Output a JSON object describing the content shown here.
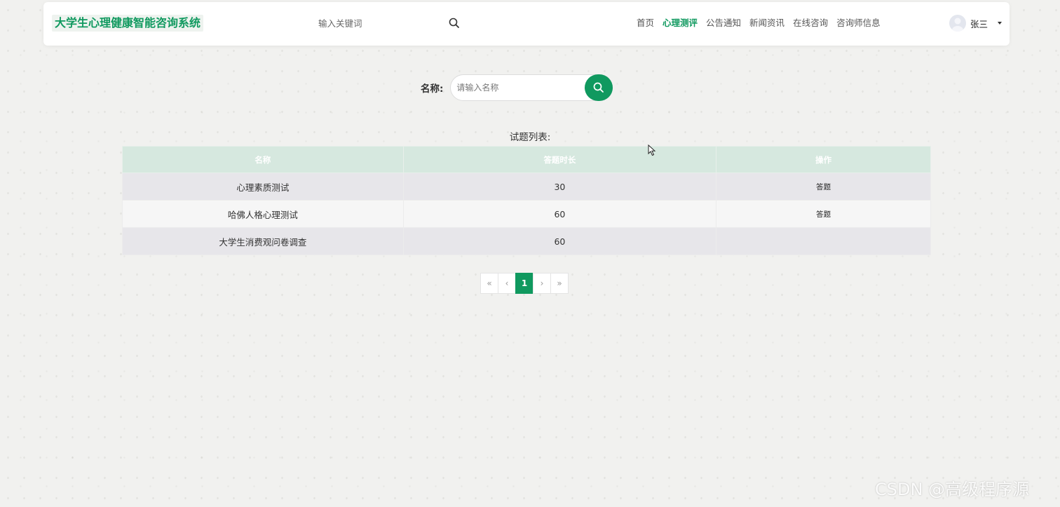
{
  "header": {
    "brand": "大学生心理健康智能咨询系统",
    "search_placeholder": "输入关键词",
    "nav": [
      {
        "label": "首页",
        "active": false
      },
      {
        "label": "心理测评",
        "active": true
      },
      {
        "label": "公告通知",
        "active": false
      },
      {
        "label": "新闻资讯",
        "active": false
      },
      {
        "label": "在线咨询",
        "active": false
      },
      {
        "label": "咨询师信息",
        "active": false
      }
    ],
    "user_name": "张三"
  },
  "filter": {
    "label": "名称:",
    "placeholder": "请输入名称"
  },
  "list": {
    "title": "试题列表:",
    "columns": [
      "名称",
      "答题时长",
      "操作"
    ],
    "rows": [
      {
        "name": "心理素质测试",
        "duration": "30",
        "action": "答题"
      },
      {
        "name": "哈佛人格心理测试",
        "duration": "60",
        "action": "答题"
      },
      {
        "name": "大学生消费观问卷调查",
        "duration": "60",
        "action": ""
      }
    ]
  },
  "pagination": {
    "first": "«",
    "prev": "‹",
    "current": "1",
    "next": "›",
    "last": "»"
  },
  "watermark": "CSDN @高级程序源",
  "colors": {
    "accent": "#10995f",
    "header_row": "#d6e8df",
    "row_odd": "#e7e6ea",
    "row_even": "#f6f6f6"
  }
}
